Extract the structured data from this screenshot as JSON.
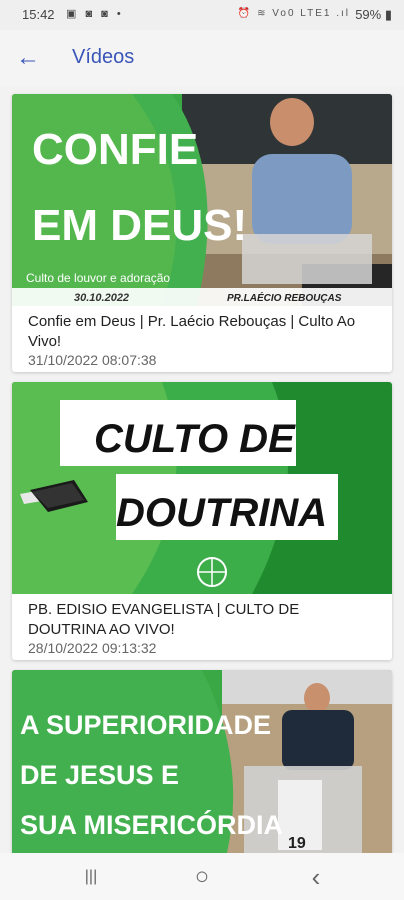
{
  "status_bar": {
    "time": "15:42",
    "left_icons": "▣ ◙ ◙ •",
    "right_icons": "⏰ ≋ Vo0 LTE1 .ıl",
    "battery": "59%"
  },
  "app_bar": {
    "back_glyph": "←",
    "title": "Vídeos"
  },
  "videos": [
    {
      "thumb": {
        "line1": "CONFIE",
        "line2": "EM DEUS!",
        "subtitle": "Culto de louvor e adoração",
        "date": "30.10.2022",
        "speaker": "PR.LAÉCIO REBOUÇAS"
      },
      "title": "Confie em Deus | Pr. Laécio Rebouças | Culto Ao Vivo!",
      "date": "31/10/2022 08:07:38"
    },
    {
      "thumb": {
        "line1": "CULTO DE",
        "line2": "DOUTRINA"
      },
      "title": "PB. EDISIO EVANGELISTA | CULTO DE DOUTRINA AO VIVO!",
      "date": "28/10/2022 09:13:32"
    },
    {
      "thumb": {
        "line1": "A SUPERIORIDADE",
        "line2": "DE JESUS E",
        "line3": "SUA MISERICÓRDIA",
        "podium_number": "19"
      }
    }
  ],
  "nav_bar": {
    "recents_glyph": "|||",
    "home_glyph": "○",
    "back_glyph": "‹"
  },
  "colors": {
    "accent": "#3a55b8",
    "green": "#3aa845",
    "dark_green": "#1f8a2e"
  }
}
